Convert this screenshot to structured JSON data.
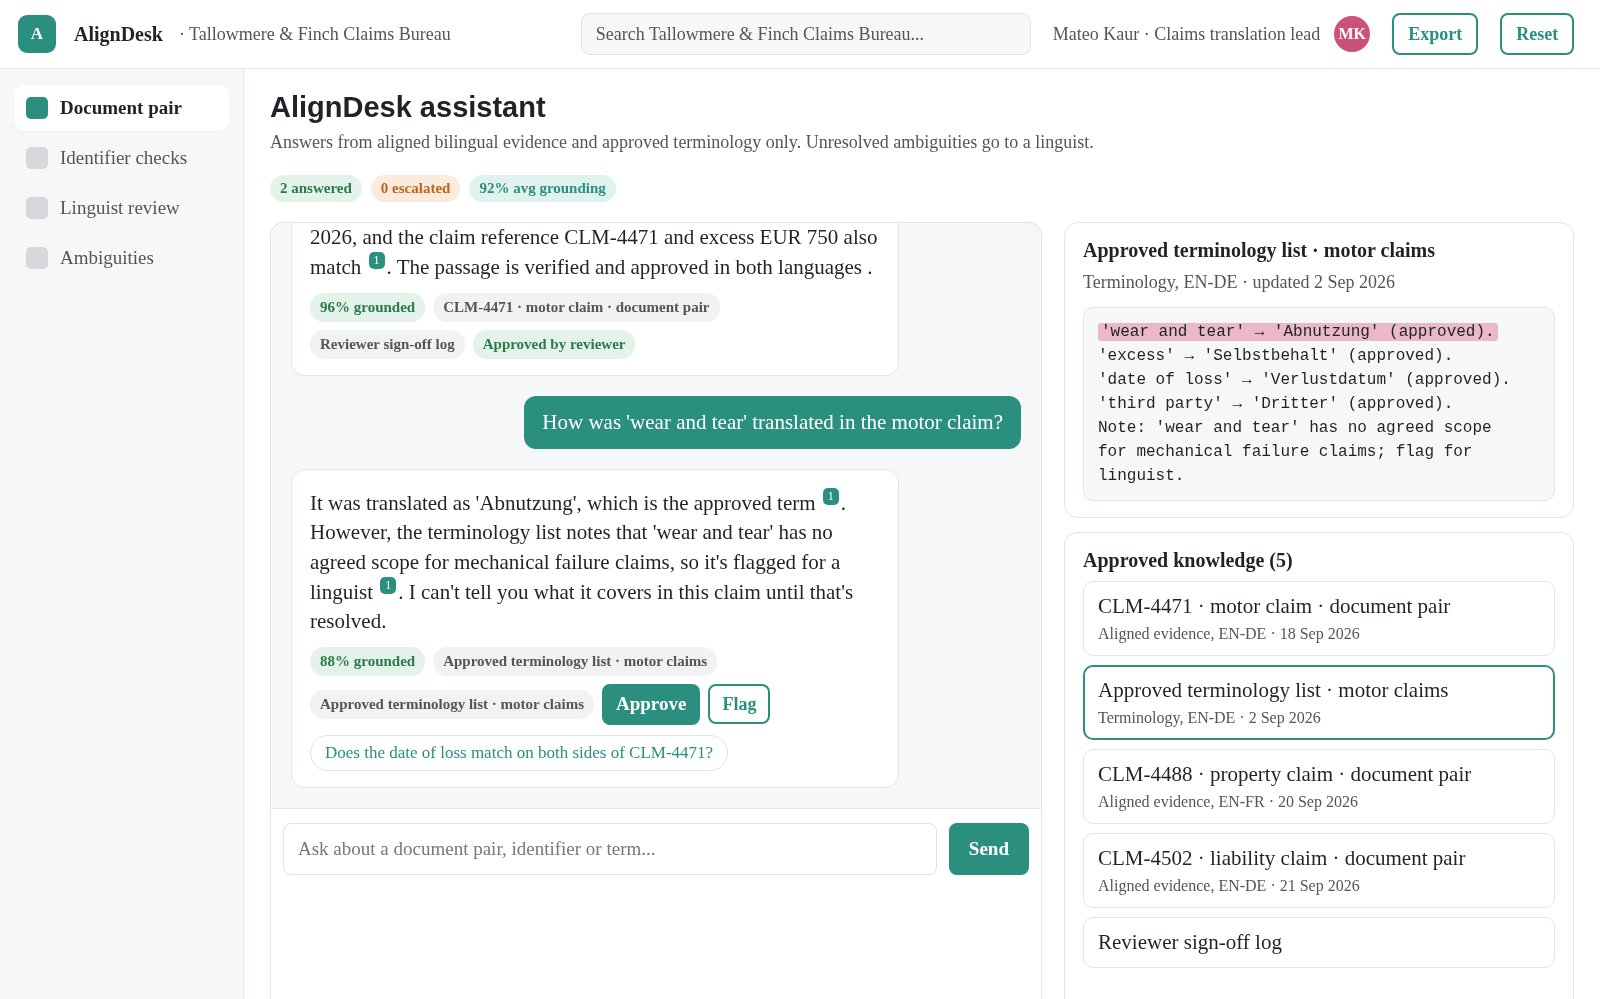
{
  "header": {
    "logo_letter": "A",
    "app_name": "AlignDesk",
    "org": "· Tallowmere & Finch Claims Bureau",
    "search": {
      "placeholder": "Search Tallowmere & Finch Claims Bureau..."
    },
    "user": "Mateo Kaur · Claims translation lead",
    "avatar": "MK",
    "buttons": [
      "Export",
      "Reset"
    ]
  },
  "sidebar": {
    "items": [
      {
        "label": "Document pair",
        "selected": true
      },
      {
        "label": "Identifier checks",
        "selected": false
      },
      {
        "label": "Linguist review",
        "selected": false
      },
      {
        "label": "Ambiguities",
        "selected": false
      }
    ]
  },
  "page": {
    "title": "AlignDesk assistant",
    "subtitle": "Answers from aligned bilingual evidence and approved terminology only. Unresolved ambiguities go to a linguist.",
    "stats": [
      {
        "text": "2 answered",
        "kind": "green"
      },
      {
        "text": "0 escalated",
        "kind": "orange"
      },
      {
        "text": "92% avg grounding",
        "kind": "teal"
      }
    ]
  },
  "chat": {
    "messages": [
      {
        "kind": "assistant",
        "continued": true,
        "segments": [
          {
            "kind": "text",
            "text": "2026, and the claim reference CLM-4471 and excess EUR 750 also match "
          },
          {
            "kind": "cite",
            "text": "1"
          },
          {
            "kind": "text",
            "text": ". The passage is verified and approved in both languages ."
          }
        ],
        "tags": [
          {
            "text": "96% grounded",
            "kind": "grounded"
          },
          {
            "text": "CLM-4471 · motor claim · document pair",
            "kind": "source"
          },
          {
            "text": "Reviewer sign-off log",
            "kind": "source"
          },
          {
            "text": "Approved by reviewer",
            "kind": "approved"
          }
        ]
      },
      {
        "kind": "user",
        "segments": [
          {
            "kind": "text",
            "text": "How was 'wear and tear' translated in the motor claim?"
          }
        ]
      },
      {
        "kind": "assistant",
        "continued": false,
        "segments": [
          {
            "kind": "text",
            "text": "It was translated as 'Abnutzung', which is the approved term "
          },
          {
            "kind": "cite",
            "text": "1"
          },
          {
            "kind": "text",
            "text": ". However, the terminology list notes that 'wear and tear' has no agreed scope for mechanical failure claims, so it's flagged for a linguist "
          },
          {
            "kind": "cite",
            "text": "1"
          },
          {
            "kind": "text",
            "text": ". I can't tell you what it covers in this claim until that's resolved."
          }
        ],
        "tags": [
          {
            "text": "88% grounded",
            "kind": "grounded"
          },
          {
            "text": "Approved terminology list · motor claims",
            "kind": "source"
          },
          {
            "text": "Approved terminology list · motor claims",
            "kind": "source"
          },
          {
            "text": "Approve",
            "kind": "approve"
          },
          {
            "text": "Flag",
            "kind": "flag"
          }
        ],
        "suggestion": "Does the date of loss match on both sides of CLM-4471?"
      }
    ],
    "input": {
      "placeholder": "Ask about a document pair, identifier or term..."
    },
    "send": "Send"
  },
  "source_card": {
    "title": "Approved terminology list · motor claims",
    "meta": "Terminology, EN-DE · updated 2 Sep 2026",
    "lines": [
      {
        "text": "'wear and tear' → 'Abnutzung' (approved).",
        "highlighted": true
      },
      {
        "text": "'excess' → 'Selbstbehalt' (approved).",
        "highlighted": false
      },
      {
        "text": "'date of loss' → 'Verlustdatum' (approved).",
        "highlighted": false
      },
      {
        "text": "'third party' → 'Dritter' (approved).",
        "highlighted": false
      },
      {
        "text": "Note: 'wear and tear' has no agreed scope for mechanical failure claims; flag for linguist.",
        "highlighted": false
      }
    ]
  },
  "knowledge": {
    "title": "Approved knowledge (5)",
    "items": [
      {
        "title": "CLM-4471 · motor claim · document pair",
        "meta": "Aligned evidence, EN-DE · 18 Sep 2026",
        "selected": false
      },
      {
        "title": "Approved terminology list · motor claims",
        "meta": "Terminology, EN-DE · 2 Sep 2026",
        "selected": true
      },
      {
        "title": "CLM-4488 · property claim · document pair",
        "meta": "Aligned evidence, EN-FR · 20 Sep 2026",
        "selected": false
      },
      {
        "title": "CLM-4502 · liability claim · document pair",
        "meta": "Aligned evidence, EN-DE · 21 Sep 2026",
        "selected": false
      },
      {
        "title": "Reviewer sign-off log",
        "selected": false
      }
    ]
  }
}
